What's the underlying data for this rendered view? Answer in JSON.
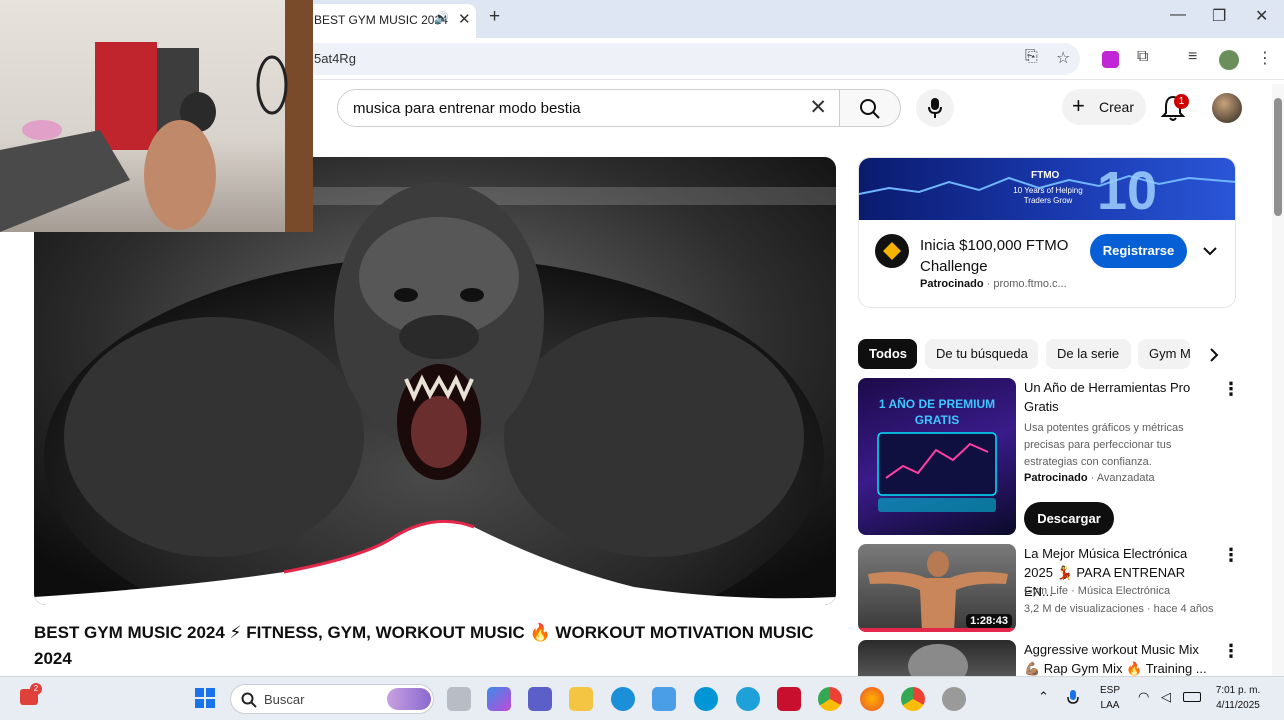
{
  "browser": {
    "tab_title": "BEST GYM MUSIC 2024",
    "url_fragment": "5at4Rg",
    "window_controls": [
      "—",
      "❐",
      "✕"
    ]
  },
  "youtube_header": {
    "search_query": "musica para entrenar modo bestia",
    "create_label": "Crear",
    "notification_count": "1"
  },
  "video": {
    "title": "BEST GYM MUSIC 2024 ⚡ FITNESS, GYM, WORKOUT MUSIC 🔥 WORKOUT MOTIVATION MUSIC 2024"
  },
  "ad": {
    "banner_brand": "FTMO",
    "banner_sub": "10 Years of Helping Traders Grow",
    "banner_number": "10",
    "title": "Inicia $100,000 FTMO Challenge",
    "sponsored": "Patrocinado",
    "domain": "promo.ftmo.c...",
    "cta": "Registrarse"
  },
  "chips": [
    "Todos",
    "De tu búsqueda",
    "De la serie",
    "Gym M"
  ],
  "recommendations": [
    {
      "thumb_text": "1 AÑO DE PREMIUM GRATIS",
      "title": "Un Año de Herramientas Pro Gratis",
      "description": "Usa potentes gráficos y métricas precisas para perfeccionar tus estrategias con confianza.",
      "sponsored": "Patrocinado",
      "advertiser": "Avanzadata",
      "cta": "Descargar"
    },
    {
      "title": "La Mejor Música Electrónica 2025 💃 PARA ENTRENAR EN...",
      "channel": "Gym Life · Música Electrónica",
      "stats": "3,2 M de visualizaciones · hace 4 años",
      "duration": "1:28:43"
    },
    {
      "title": "Aggressive workout Music Mix 💪🏽 Rap Gym Mix 🔥 Training ..."
    }
  ],
  "taskbar": {
    "search_label": "Buscar",
    "notification_badge": "2",
    "lang_top": "ESP",
    "lang_bottom": "LAA",
    "time": "7:01 p. m.",
    "date": "4/11/2025"
  }
}
